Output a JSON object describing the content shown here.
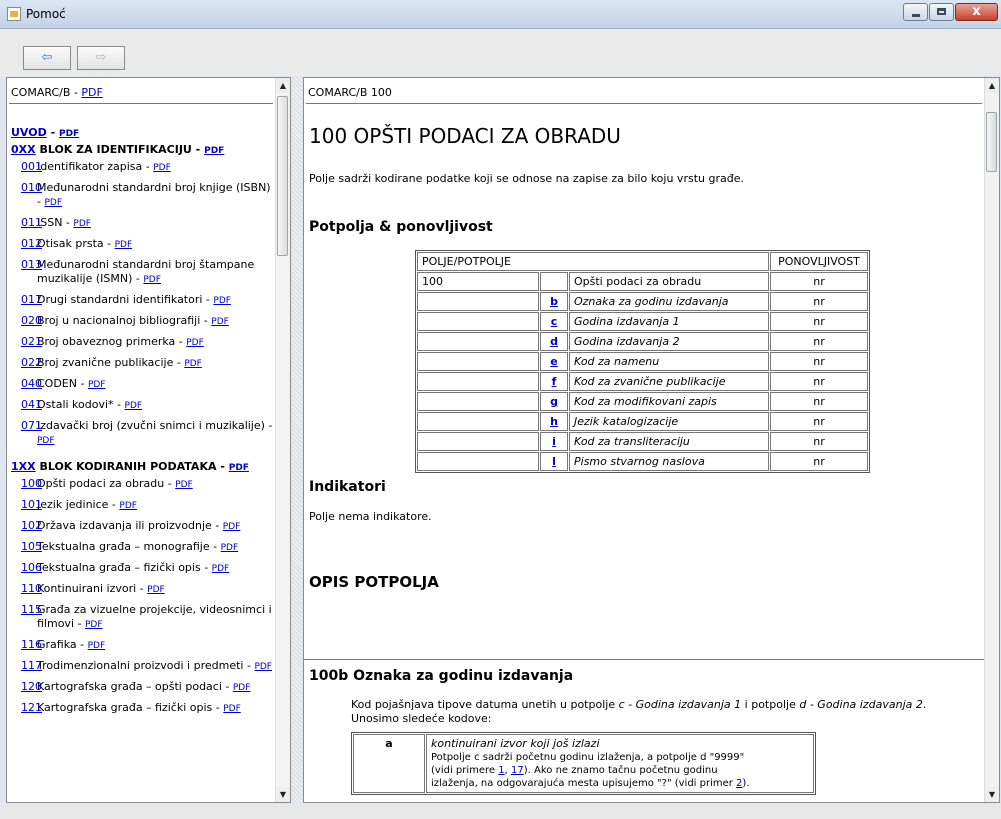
{
  "window": {
    "title": "Pomoć",
    "close_glyph": "x"
  },
  "toolbar": {
    "back_icon": "arrow-left-icon",
    "forward_icon": "arrow-right-icon",
    "back_glyph": "⇦",
    "forward_glyph": "⇨"
  },
  "scroll": {
    "up": "▲",
    "down": "▼"
  },
  "left": {
    "breadcrumb": "COMARC/B - ",
    "breadcrumb_pdf": "PDF",
    "uvod": "UVOD",
    "sep": " - ",
    "pdf": "PDF",
    "group0": {
      "code": "0XX",
      "label": " BLOK ZA IDENTIFIKACIJU - "
    },
    "group0_items": [
      {
        "code": "001",
        "label": "Identifikator zapisa - "
      },
      {
        "code": "010",
        "label": "Međunarodni standardni broj knjige (ISBN) - "
      },
      {
        "code": "011",
        "label": "ISSN - "
      },
      {
        "code": "012",
        "label": "Otisak prsta - "
      },
      {
        "code": "013",
        "label": "Međunarodni standardni broj štampane muzikalije (ISMN) - "
      },
      {
        "code": "017",
        "label": "Drugi standardni identifikatori - "
      },
      {
        "code": "020",
        "label": "Broj u nacionalnoj bibliografiji - "
      },
      {
        "code": "021",
        "label": "Broj obaveznog primerka - "
      },
      {
        "code": "022",
        "label": "Broj zvanične publikacije - "
      },
      {
        "code": "040",
        "label": "CODEN - "
      },
      {
        "code": "041",
        "label": "Ostali kodovi* - "
      },
      {
        "code": "071",
        "label": "Izdavački broj (zvučni snimci i muzikalije) - "
      }
    ],
    "group1": {
      "code": "1XX",
      "label": " BLOK KODIRANIH PODATAKA - "
    },
    "group1_items": [
      {
        "code": "100",
        "label": "Opšti podaci za obradu - "
      },
      {
        "code": "101",
        "label": "Jezik jedinice - "
      },
      {
        "code": "102",
        "label": "Država izdavanja ili proizvodnje - "
      },
      {
        "code": "105",
        "label": "Tekstualna građa – monografije - "
      },
      {
        "code": "106",
        "label": "Tekstualna građa – fizički opis - "
      },
      {
        "code": "110",
        "label": "Kontinuirani izvori - "
      },
      {
        "code": "115",
        "label": "Građa za vizuelne projekcije, videosnimci i filmovi - "
      },
      {
        "code": "116",
        "label": "Grafika - "
      },
      {
        "code": "117",
        "label": "Trodimenzionalni proizvodi i predmeti - "
      },
      {
        "code": "120",
        "label": "Kartografska građa – opšti podaci - "
      },
      {
        "code": "121",
        "label": "Kartografska građa – fizički opis - "
      }
    ]
  },
  "right": {
    "breadcrumb": "COMARC/B 100",
    "title": "100 OPŠTI PODACI ZA OBRADU",
    "intro": "Polje sadrži kodirane podatke koji se odnose na zapise za bilo koju vrstu građe.",
    "sub_heading": "Potpolja & ponovljivost",
    "table_headers": {
      "field": "POLJE/POTPOLJE",
      "rep": "PONOVLJIVOST"
    },
    "table_rows": [
      {
        "field": "100",
        "code": "",
        "name": "Opšti podaci za obradu",
        "rep": "nr"
      },
      {
        "field": "",
        "code": "b",
        "name": "Oznaka za godinu izdavanja",
        "rep": "nr"
      },
      {
        "field": "",
        "code": "c",
        "name": "Godina izdavanja 1",
        "rep": "nr"
      },
      {
        "field": "",
        "code": "d",
        "name": "Godina izdavanja 2",
        "rep": "nr"
      },
      {
        "field": "",
        "code": "e",
        "name": "Kod za namenu",
        "rep": "nr"
      },
      {
        "field": "",
        "code": "f",
        "name": "Kod za zvanične publikacije",
        "rep": "nr"
      },
      {
        "field": "",
        "code": "g",
        "name": "Kod za modifikovani zapis",
        "rep": "nr"
      },
      {
        "field": "",
        "code": "h",
        "name": "Jezik katalogizacije",
        "rep": "nr"
      },
      {
        "field": "",
        "code": "i",
        "name": "Kod za transliteraciju",
        "rep": "nr"
      },
      {
        "field": "",
        "code": "l",
        "name": "Pismo stvarnog naslova",
        "rep": "nr"
      }
    ],
    "indicators_heading": "Indikatori",
    "indicators_text": "Polje nema indikatore.",
    "desc_heading": "OPIS POTPOLJA",
    "sub_b_heading": "100b Oznaka za godinu izdavanja",
    "sub_b_text": [
      "Kod pojašnjava tipove datuma unetih u potpolje ",
      "c - Godina izdavanja 1",
      " i potpolje ",
      "d - Godina izdavanja 2",
      "."
    ],
    "sub_b_text2": "Unosimo sledeće kodove:",
    "code_a": {
      "key": "a",
      "title": "kontinuirani izvor koji još izlazi",
      "line1": "Potpolje c sadrži početnu godinu izlaženja, a potpolje d \"9999\"",
      "line2a": "(vidi primere ",
      "ref1": "1",
      "line2b": ", ",
      "ref2": "17",
      "line2c": "). Ako ne znamo tačnu početnu godinu",
      "line3a": "izlaženja, na odgovarajuća mesta upisujemo \"?\" (vidi primer ",
      "ref3": "2",
      "line3b": ")."
    }
  }
}
